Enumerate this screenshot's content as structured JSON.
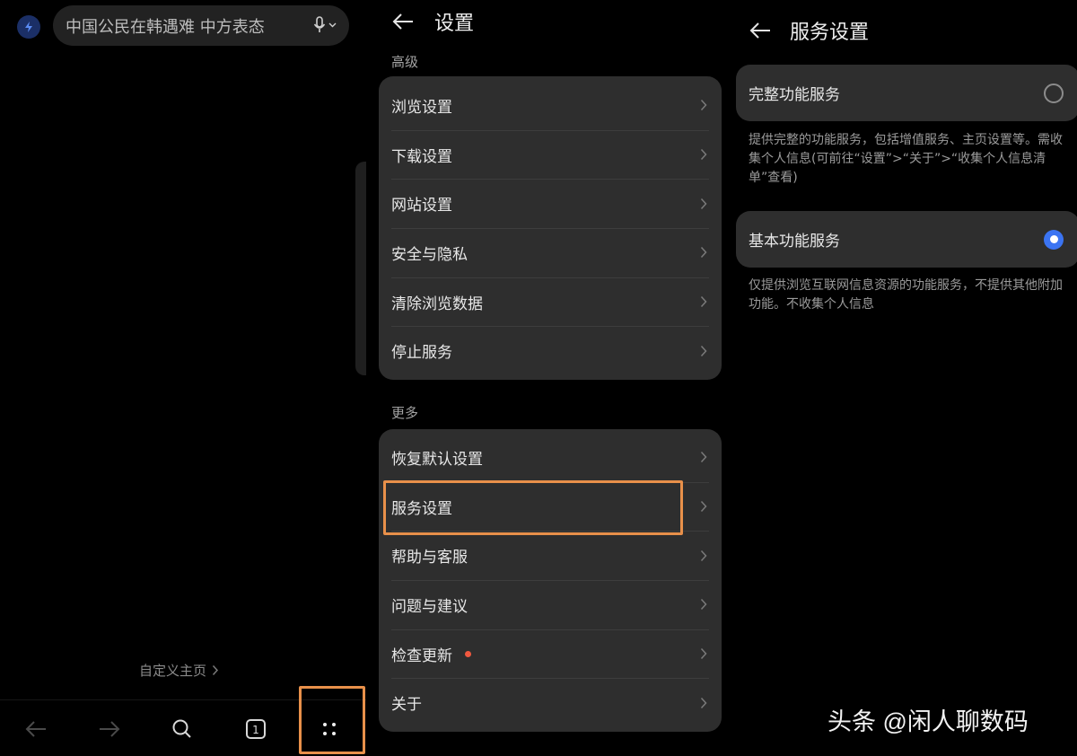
{
  "left_panel": {
    "search": {
      "text": "中国公民在韩遇难 中方表态"
    },
    "customize_home": "自定义主页",
    "bottom_bar": {
      "tab_count": "1"
    }
  },
  "middle_panel": {
    "title": "设置",
    "sections": [
      {
        "label": "高级",
        "items": [
          "浏览设置",
          "下载设置",
          "网站设置",
          "安全与隐私",
          "清除浏览数据",
          "停止服务"
        ]
      },
      {
        "label": "更多",
        "items": [
          "恢复默认设置",
          "服务设置",
          "帮助与客服",
          "问题与建议",
          "检查更新",
          "关于"
        ]
      }
    ]
  },
  "right_panel": {
    "title": "服务设置",
    "options": [
      {
        "label": "完整功能服务",
        "selected": false,
        "description": "提供完整的功能服务，包括增值服务、主页设置等。需收集个人信息(可前往“设置”>“关于”>“收集个人信息清单”查看)"
      },
      {
        "label": "基本功能服务",
        "selected": true,
        "description": "仅提供浏览互联网信息资源的功能服务，不提供其他附加功能。不收集个人信息"
      }
    ]
  },
  "watermark": "头条 @闲人聊数码",
  "colors": {
    "accent_blue": "#3b74f2",
    "highlight_orange": "#e8904a",
    "notify_red": "#f0583f"
  }
}
